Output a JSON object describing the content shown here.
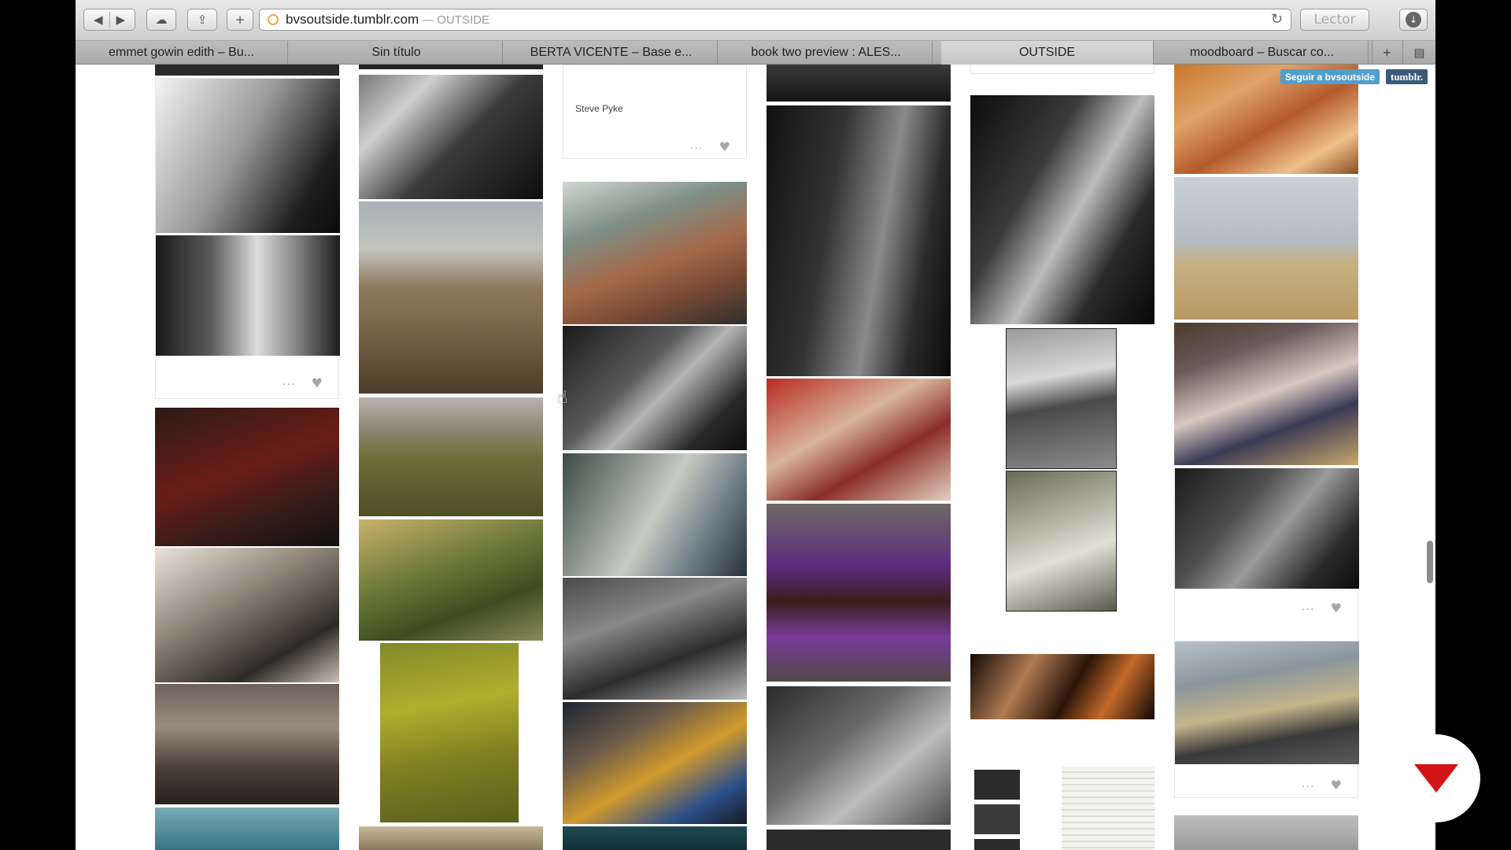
{
  "browser": {
    "url": "bvsoutside.tumblr.com",
    "page_title": "— OUTSIDE",
    "reader_label": "Lector",
    "tabs": [
      {
        "label": "emmet gowin edith – Bu...",
        "active": false
      },
      {
        "label": "Sin título",
        "active": false
      },
      {
        "label": "BERTA VICENTE – Base e...",
        "active": false
      },
      {
        "label": "book two preview : ALES...",
        "active": false
      },
      {
        "label": "OUTSIDE",
        "active": true
      },
      {
        "label": "moodboard – Buscar co...",
        "active": false
      }
    ],
    "icons": {
      "back": "back-arrow-icon",
      "forward": "forward-arrow-icon",
      "cloud": "icloud-tabs-icon",
      "share": "share-icon",
      "add": "add-tab-icon",
      "reload": "reload-icon",
      "download": "download-icon"
    }
  },
  "tumblr": {
    "follow_label": "Seguir a bvsoutside",
    "logo_label": "tumblr.",
    "caption": "Steve Pyke",
    "dots": "···",
    "heart": "♥"
  },
  "colors": {
    "follow_blue": "#529ecc",
    "tumblr_navy": "#3a5a7a",
    "badge_red": "#d41414"
  }
}
